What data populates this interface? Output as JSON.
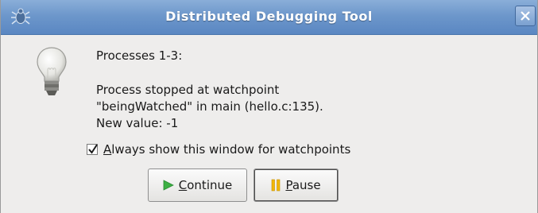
{
  "window": {
    "title": "Distributed Debugging Tool",
    "app_icon": "debugger-bug-icon",
    "close_icon": "close-icon"
  },
  "message": {
    "icon": "lightbulb-icon",
    "header": "Processes 1-3:",
    "line1": "Process stopped at watchpoint",
    "line2": "\"beingWatched\" in main (hello.c:135).",
    "line3": "New value: -1"
  },
  "checkbox": {
    "checked": true,
    "mnemonic": "A",
    "label_rest": "lways show this window for watchpoints"
  },
  "buttons": {
    "continue": {
      "mnemonic": "C",
      "rest": "ontinue",
      "icon": "play-icon",
      "icon_color": "#3cb043"
    },
    "pause": {
      "mnemonic": "P",
      "rest": "ause",
      "icon": "pause-icon",
      "icon_color": "#f2b705"
    }
  },
  "colors": {
    "titlebar": "#6d97cb",
    "dialog_bg": "#eeedec"
  }
}
